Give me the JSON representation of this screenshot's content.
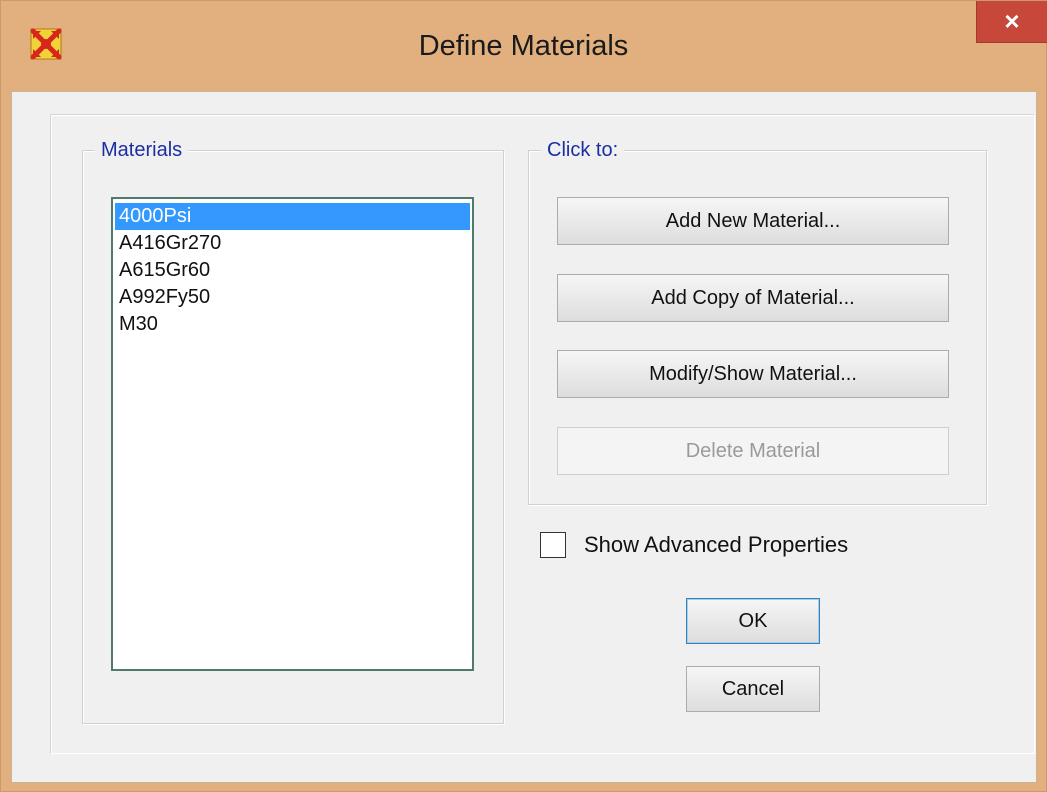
{
  "window": {
    "title": "Define Materials",
    "close_label": "×"
  },
  "materials": {
    "legend": "Materials",
    "items": [
      "4000Psi",
      "A416Gr270",
      "A615Gr60",
      "A992Fy50",
      "M30"
    ],
    "selected_index": 0
  },
  "actions": {
    "legend": "Click to:",
    "add_new": "Add New Material...",
    "add_copy": "Add Copy of Material...",
    "modify_show": "Modify/Show Material...",
    "delete": "Delete Material"
  },
  "options": {
    "show_advanced_label": "Show Advanced Properties",
    "show_advanced_checked": false
  },
  "dialog_buttons": {
    "ok": "OK",
    "cancel": "Cancel"
  },
  "colors": {
    "titlebar": "#e2b07f",
    "close": "#c7473b",
    "selection": "#3399ff",
    "group_legend": "#1b2fa3"
  }
}
